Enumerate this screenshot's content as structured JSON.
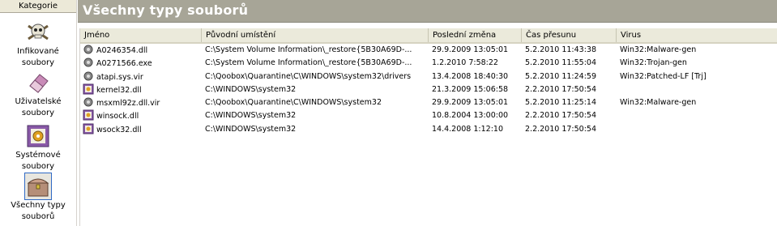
{
  "sidebar": {
    "header": "Kategorie",
    "items": [
      {
        "label_line1": "Infikované",
        "label_line2": "soubory",
        "icon": "skull-icon"
      },
      {
        "label_line1": "Uživatelské",
        "label_line2": "soubory",
        "icon": "eraser-icon"
      },
      {
        "label_line1": "Systémové",
        "label_line2": "soubory",
        "icon": "system-file-icon"
      },
      {
        "label_line1": "Všechny typy",
        "label_line2": "souborů",
        "icon": "chest-icon"
      }
    ]
  },
  "title": "Všechny typy souborů",
  "columns": [
    "Jméno",
    "Původní umístění",
    "Poslední změna",
    "Čas přesunu",
    "Virus"
  ],
  "rows": [
    {
      "icon": "gear-icon",
      "name": "A0246354.dll",
      "location": "C:\\System Volume Information\\_restore{5B30A69D-...",
      "modified": "29.9.2009 13:05:01",
      "moved": "5.2.2010 11:43:38",
      "virus": "Win32:Malware-gen"
    },
    {
      "icon": "gear-icon",
      "name": "A0271566.exe",
      "location": "C:\\System Volume Information\\_restore{5B30A69D-...",
      "modified": "1.2.2010 7:58:22",
      "moved": "5.2.2010 11:55:04",
      "virus": "Win32:Trojan-gen"
    },
    {
      "icon": "gear-icon",
      "name": "atapi.sys.vir",
      "location": "C:\\Qoobox\\Quarantine\\C\\WINDOWS\\system32\\drivers",
      "modified": "13.4.2008 18:40:30",
      "moved": "5.2.2010 11:24:59",
      "virus": "Win32:Patched-LF [Trj]"
    },
    {
      "icon": "dll-icon",
      "name": "kernel32.dll",
      "location": "C:\\WINDOWS\\system32",
      "modified": "21.3.2009 15:06:58",
      "moved": "2.2.2010 17:50:54",
      "virus": ""
    },
    {
      "icon": "gear-icon",
      "name": "msxml92z.dll.vir",
      "location": "C:\\Qoobox\\Quarantine\\C\\WINDOWS\\system32",
      "modified": "29.9.2009 13:05:01",
      "moved": "5.2.2010 11:25:14",
      "virus": "Win32:Malware-gen"
    },
    {
      "icon": "dll-icon",
      "name": "winsock.dll",
      "location": "C:\\WINDOWS\\system32",
      "modified": "10.8.2004 13:00:00",
      "moved": "2.2.2010 17:50:54",
      "virus": ""
    },
    {
      "icon": "dll-icon",
      "name": "wsock32.dll",
      "location": "C:\\WINDOWS\\system32",
      "modified": "14.4.2008 1:12:10",
      "moved": "2.2.2010 17:50:54",
      "virus": ""
    }
  ],
  "colors": {
    "titlebar": "#a7a597",
    "header_bg": "#ebeadb",
    "selected_outline": "#316ac5"
  }
}
